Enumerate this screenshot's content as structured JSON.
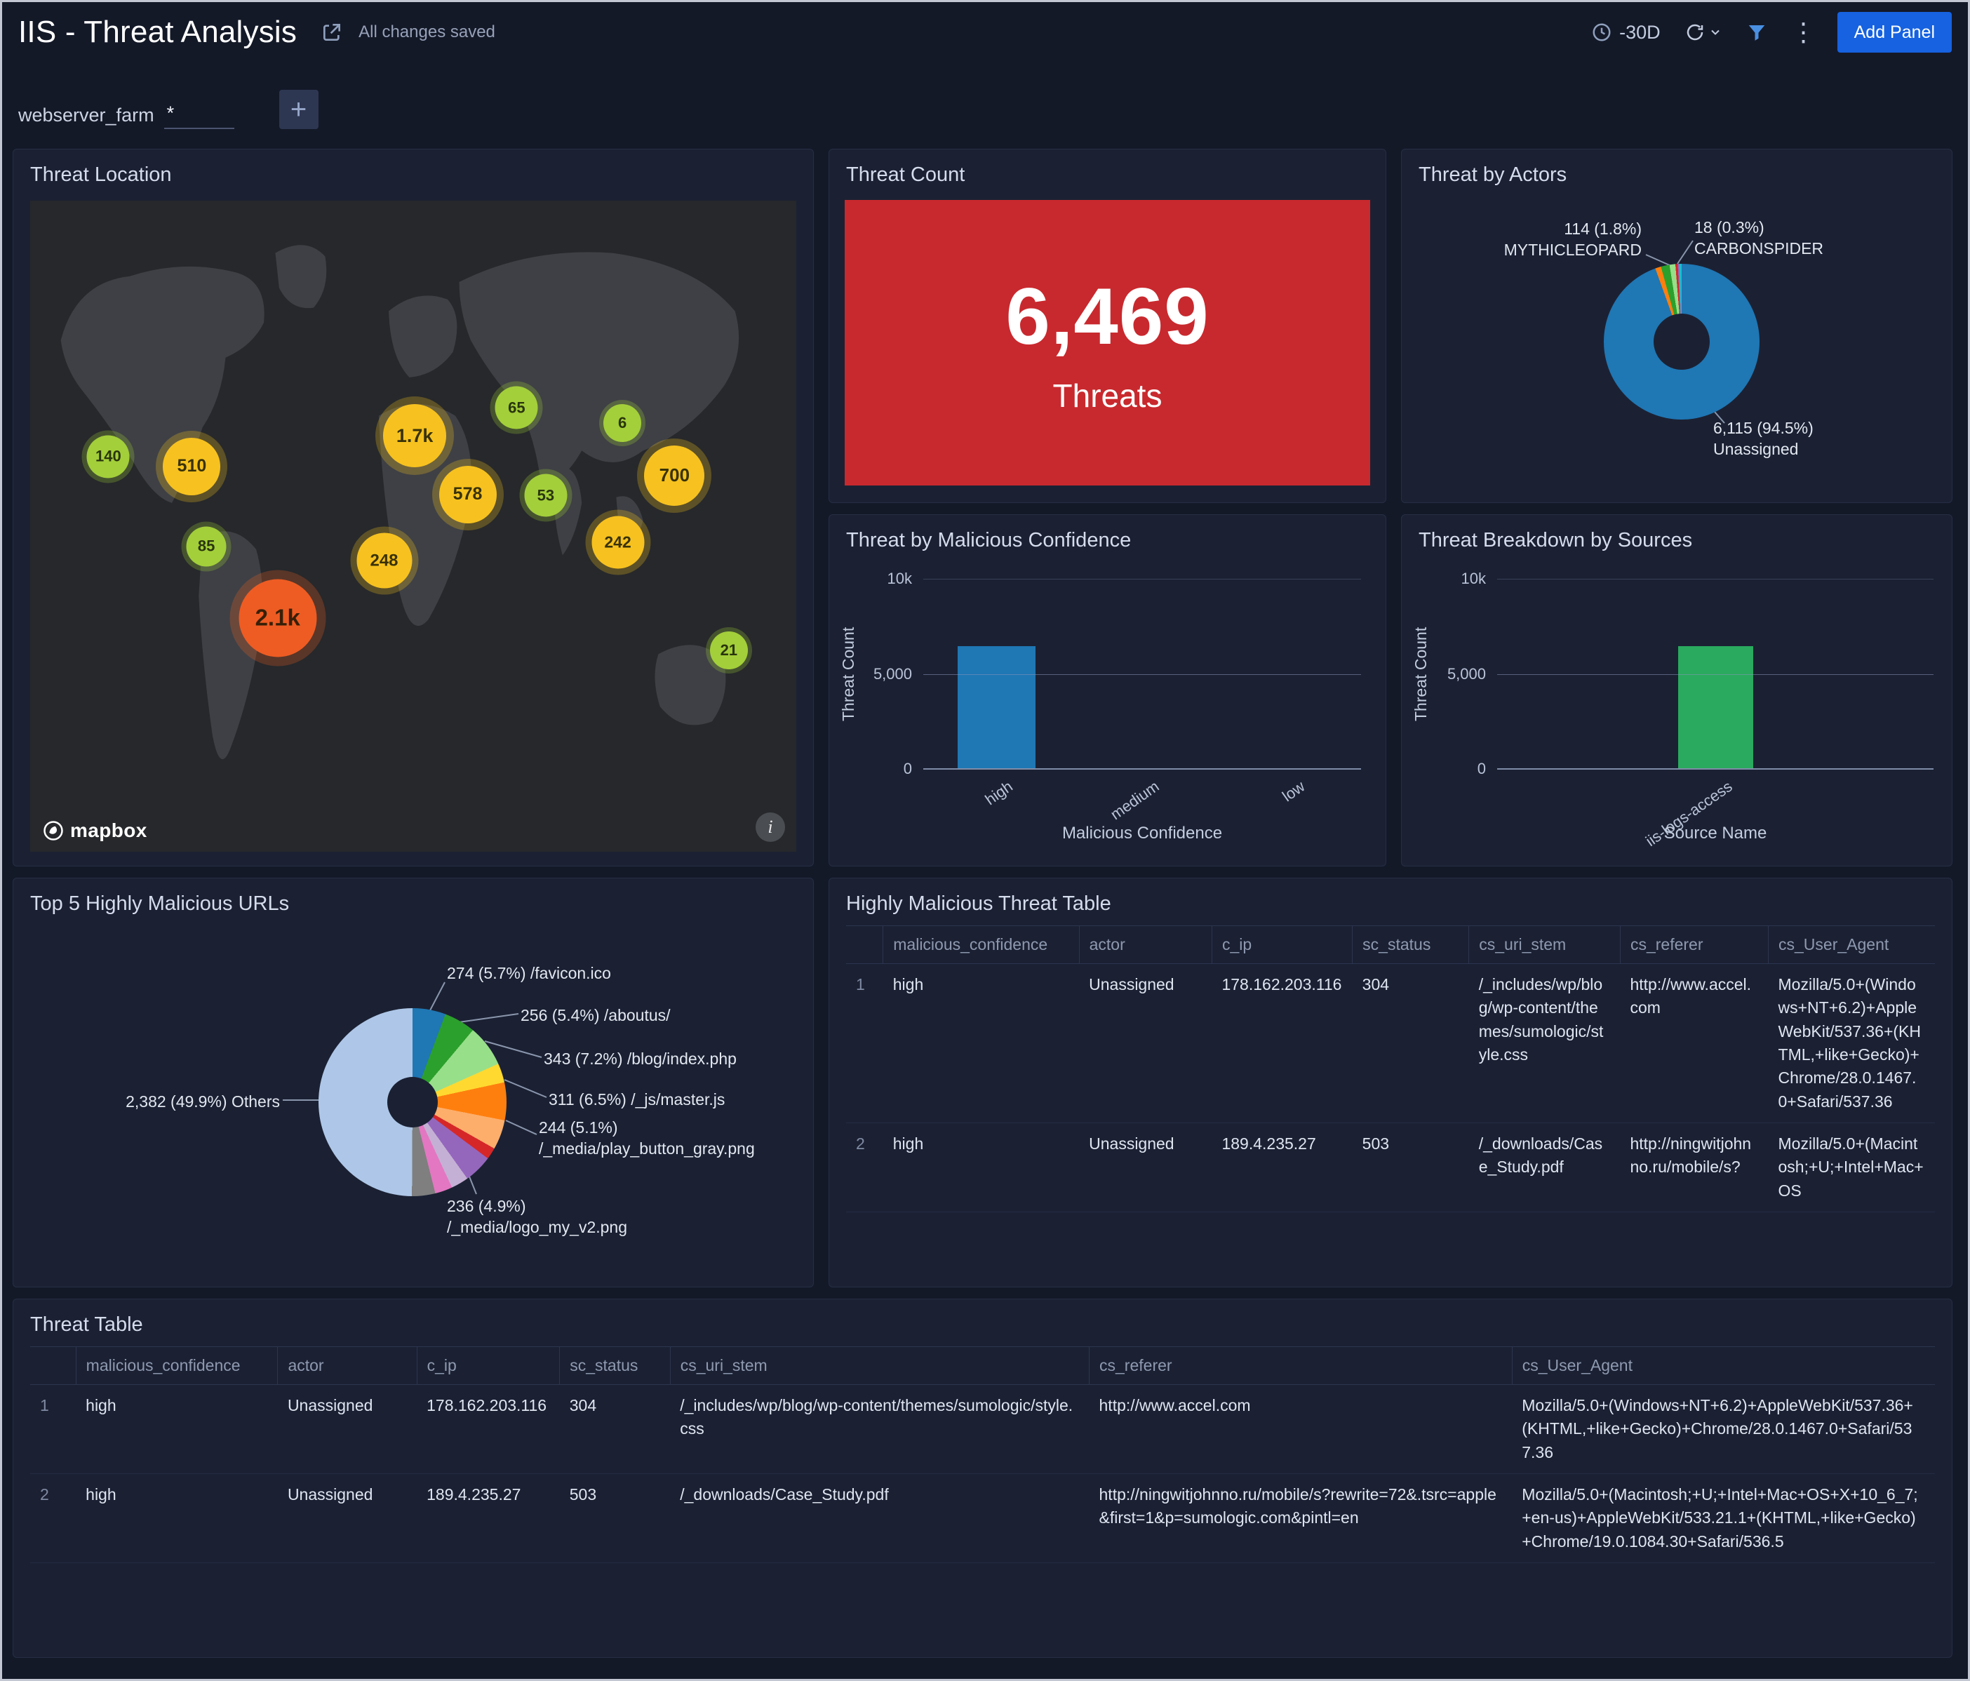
{
  "window": {
    "title": "IIS - Threat Analysis",
    "save_status": "All changes saved",
    "time_range": "-30D",
    "add_panel_label": "Add Panel"
  },
  "icons": {
    "kebab": "⋮",
    "plus": "+",
    "info": "i",
    "map_attribution": "mapbox"
  },
  "filter_bar": {
    "name": "webserver_farm",
    "value": "*"
  },
  "panels": {
    "threat_location": {
      "title": "Threat Location",
      "chart_data": {
        "type": "map-bubbles",
        "bubbles": [
          {
            "label": "140",
            "value": 140,
            "x": 10.2,
            "y": 39.3,
            "d": 61,
            "color": "green"
          },
          {
            "label": "510",
            "value": 510,
            "x": 21.1,
            "y": 40.8,
            "d": 82,
            "color": "yellow"
          },
          {
            "label": "85",
            "value": 85,
            "x": 23.0,
            "y": 53.1,
            "d": 57,
            "color": "green"
          },
          {
            "label": "2.1k",
            "value": 2100,
            "x": 32.3,
            "y": 64.1,
            "d": 111,
            "color": "orange"
          },
          {
            "label": "248",
            "value": 248,
            "x": 46.2,
            "y": 55.3,
            "d": 79,
            "color": "yellow"
          },
          {
            "label": "1.7k",
            "value": 1700,
            "x": 50.2,
            "y": 36.1,
            "d": 90,
            "color": "yellow"
          },
          {
            "label": "578",
            "value": 578,
            "x": 57.1,
            "y": 45.1,
            "d": 82,
            "color": "yellow"
          },
          {
            "label": "65",
            "value": 65,
            "x": 63.5,
            "y": 31.8,
            "d": 61,
            "color": "green"
          },
          {
            "label": "53",
            "value": 53,
            "x": 67.3,
            "y": 45.3,
            "d": 61,
            "color": "green"
          },
          {
            "label": "6",
            "value": 6,
            "x": 77.3,
            "y": 34.2,
            "d": 54,
            "color": "green"
          },
          {
            "label": "700",
            "value": 700,
            "x": 84.1,
            "y": 42.2,
            "d": 86,
            "color": "yellow"
          },
          {
            "label": "242",
            "value": 242,
            "x": 76.7,
            "y": 52.5,
            "d": 75,
            "color": "yellow"
          },
          {
            "label": "21",
            "value": 21,
            "x": 91.2,
            "y": 69.1,
            "d": 54,
            "color": "green"
          }
        ],
        "bubble_colors": {
          "green": "#a3cf3a",
          "yellow": "#f7c21f",
          "orange": "#ee5c23"
        }
      }
    },
    "threat_count": {
      "title": "Threat Count",
      "value": "6,469",
      "unit": "Threats",
      "tile_color": "#c8292e"
    },
    "threat_by_actors": {
      "title": "Threat by Actors",
      "chart_data": {
        "type": "pie",
        "slices": [
          {
            "name": "Unassigned",
            "value": 6115,
            "pct": 94.5,
            "color": "#1f77b4",
            "label": "6,115 (94.5%)\nUnassigned"
          },
          {
            "name": "",
            "pct": 1.2,
            "color": "#ff7f0e"
          },
          {
            "name": "MYTHICLEOPARD",
            "value": 114,
            "pct": 1.8,
            "color": "#2ca02c",
            "label": "114 (1.8%)\nMYTHICLEOPARD"
          },
          {
            "name": "",
            "pct": 1.2,
            "color": "#98df8a"
          },
          {
            "name": "",
            "pct": 0.5,
            "color": "#d62728"
          },
          {
            "name": "CARBONSPIDER",
            "value": 18,
            "pct": 0.3,
            "color": "#9467bd",
            "label": "18 (0.3%)\nCARBONSPIDER"
          },
          {
            "name": "",
            "pct": 0.5,
            "color": "#17becf"
          }
        ]
      }
    },
    "threat_by_malicious_confidence": {
      "title": "Threat by Malicious Confidence",
      "chart_data": {
        "type": "bar",
        "categories": [
          "high",
          "medium",
          "low"
        ],
        "values": [
          6469,
          0,
          0
        ],
        "ylabel": "Threat Count",
        "xlabel": "Malicious Confidence",
        "ymax": 10000,
        "yticks": [
          {
            "v": 0,
            "label": "0"
          },
          {
            "v": 5000,
            "label": "5,000"
          },
          {
            "v": 10000,
            "label": "10k"
          }
        ],
        "bar_color": "#1f77b4"
      }
    },
    "threat_breakdown_by_sources": {
      "title": "Threat Breakdown by Sources",
      "chart_data": {
        "type": "bar",
        "categories": [
          "iis-logs-access"
        ],
        "values": [
          6469
        ],
        "ylabel": "Threat Count",
        "xlabel": "Source Name",
        "ymax": 10000,
        "yticks": [
          {
            "v": 0,
            "label": "0"
          },
          {
            "v": 5000,
            "label": "5,000"
          },
          {
            "v": 10000,
            "label": "10k"
          }
        ],
        "bar_color": "#2aaa5e"
      }
    },
    "top_5_highly_malicious_urls": {
      "title": "Top 5 Highly Malicious URLs",
      "chart_data": {
        "type": "pie",
        "slices": [
          {
            "name": "/favicon.ico",
            "value": 274,
            "pct": 5.7,
            "color": "#1f77b4",
            "label": "274 (5.7%) /favicon.ico"
          },
          {
            "name": "/aboutus/",
            "value": 256,
            "pct": 5.4,
            "color": "#2ca02c",
            "label": "256 (5.4%) /aboutus/"
          },
          {
            "name": "/blog/index.php",
            "value": 343,
            "pct": 7.2,
            "color": "#98df8a",
            "label": "343 (7.2%) /blog/index.php"
          },
          {
            "name": "",
            "pct": 3.3,
            "color": "#ffd92f"
          },
          {
            "name": "/_js/master.js",
            "value": 311,
            "pct": 6.5,
            "color": "#ff7f0e",
            "label": "311 (6.5%) /_js/master.js"
          },
          {
            "name": "/_media/play_button_gray.png",
            "value": 244,
            "pct": 5.1,
            "color": "#fdae6b",
            "label": "244 (5.1%)\n/_media/play_button_gray.png"
          },
          {
            "name": "",
            "pct": 2.0,
            "color": "#d62728"
          },
          {
            "name": "/_media/logo_my_v2.png",
            "value": 236,
            "pct": 4.9,
            "color": "#9467bd",
            "label": "236 (4.9%)\n/_media/logo_my_v2.png"
          },
          {
            "name": "",
            "pct": 3.0,
            "color": "#c5b0d5"
          },
          {
            "name": "",
            "pct": 3.0,
            "color": "#e377c2"
          },
          {
            "name": "",
            "pct": 4.0,
            "color": "#7f7f7f"
          },
          {
            "name": "Others",
            "value": 2382,
            "pct": 49.9,
            "color": "#aec7e8",
            "label": "2,382 (49.9%) Others"
          }
        ]
      }
    },
    "highly_malicious_threat_table": {
      "title": "Highly Malicious Threat Table",
      "columns": [
        "malicious_confidence",
        "actor",
        "c_ip",
        "sc_status",
        "cs_uri_stem",
        "cs_referer",
        "cs_User_Agent"
      ],
      "rows": [
        [
          "high",
          "Unassigned",
          "178.162.203.116",
          "304",
          "/_includes/wp/blog/wp-content/themes/sumologic/style.css",
          "http://www.accel.com",
          "Mozilla/5.0+(Windows+NT+6.2)+AppleWebKit/537.36+(KHTML,+like+Gecko)+Chrome/28.0.1467.0+Safari/537.36"
        ],
        [
          "high",
          "Unassigned",
          "189.4.235.27",
          "503",
          "/_downloads/Case_Study.pdf",
          "http://ningwitjohnno.ru/mobile/s?",
          "Mozilla/5.0+(Macintosh;+U;+Intel+Mac+OS"
        ]
      ]
    },
    "threat_table": {
      "title": "Threat Table",
      "columns": [
        "malicious_confidence",
        "actor",
        "c_ip",
        "sc_status",
        "cs_uri_stem",
        "cs_referer",
        "cs_User_Agent"
      ],
      "rows": [
        [
          "high",
          "Unassigned",
          "178.162.203.116",
          "304",
          "/_includes/wp/blog/wp-content/themes/sumologic/style.css",
          "http://www.accel.com",
          "Mozilla/5.0+(Windows+NT+6.2)+AppleWebKit/537.36+(KHTML,+like+Gecko)+Chrome/28.0.1467.0+Safari/537.36"
        ],
        [
          "high",
          "Unassigned",
          "189.4.235.27",
          "503",
          "/_downloads/Case_Study.pdf",
          "http://ningwitjohnno.ru/mobile/s?rewrite=72&.tsrc=apple&first=1&p=sumologic.com&pintl=en",
          "Mozilla/5.0+(Macintosh;+U;+Intel+Mac+OS+X+10_6_7;+en-us)+AppleWebKit/533.21.1+(KHTML,+like+Gecko)+Chrome/19.0.1084.30+Safari/536.5"
        ]
      ]
    }
  }
}
